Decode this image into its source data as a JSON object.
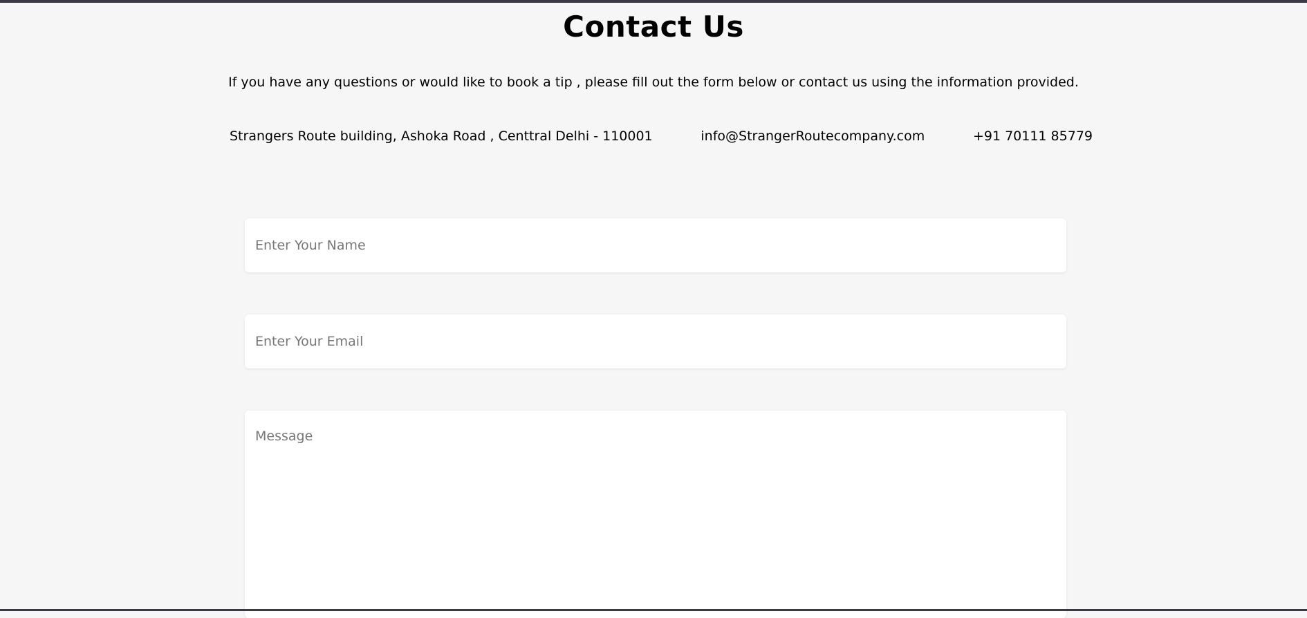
{
  "page": {
    "title": "Contact Us",
    "intro": "If you have any questions or would like to book a tip , please fill out the form below or contact us using the information provided."
  },
  "contact": {
    "address": "Strangers Route building, Ashoka Road , Centtral Delhi - 110001",
    "email": "info@StrangerRoutecompany.com",
    "phone": "+91 70111 85779"
  },
  "form": {
    "name_placeholder": "Enter Your Name",
    "email_placeholder": "Enter Your Email",
    "message_placeholder": "Message"
  }
}
